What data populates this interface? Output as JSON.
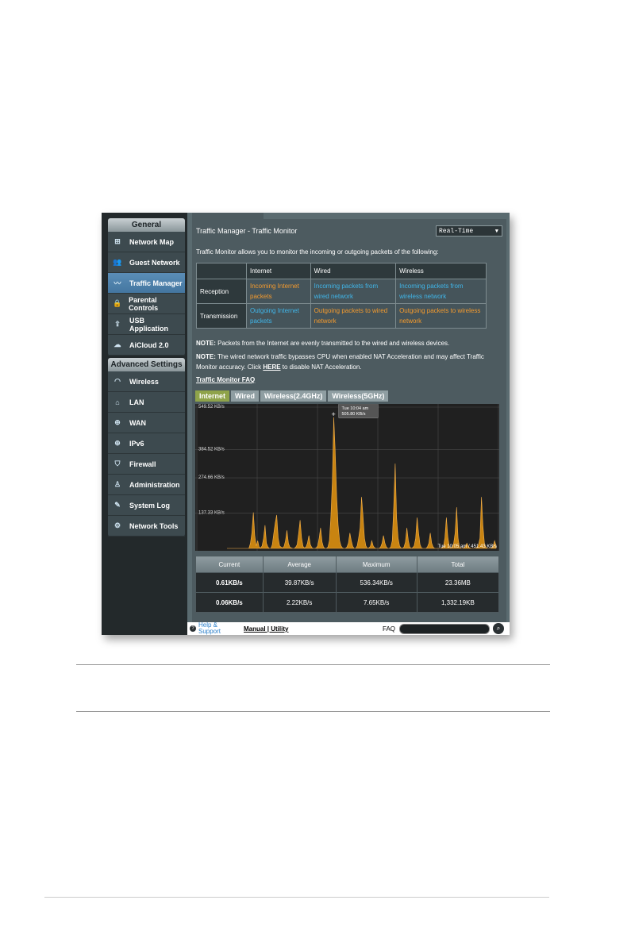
{
  "sidebar": {
    "general_title": "General",
    "general_items": [
      {
        "label": "Network Map",
        "icon": "network-map-icon"
      },
      {
        "label": "Guest Network",
        "icon": "guest-network-icon"
      },
      {
        "label": "Traffic Manager",
        "icon": "traffic-manager-icon",
        "active": true
      },
      {
        "label": "Parental Controls",
        "icon": "lock-icon"
      },
      {
        "label": "USB Application",
        "icon": "usb-icon"
      },
      {
        "label": "AiCloud 2.0",
        "icon": "cloud-icon"
      }
    ],
    "advanced_title": "Advanced Settings",
    "advanced_items": [
      {
        "label": "Wireless",
        "icon": "wifi-icon"
      },
      {
        "label": "LAN",
        "icon": "home-icon"
      },
      {
        "label": "WAN",
        "icon": "globe-icon"
      },
      {
        "label": "IPv6",
        "icon": "ipv6-icon"
      },
      {
        "label": "Firewall",
        "icon": "shield-icon"
      },
      {
        "label": "Administration",
        "icon": "user-icon"
      },
      {
        "label": "System Log",
        "icon": "log-icon"
      },
      {
        "label": "Network Tools",
        "icon": "tools-icon"
      }
    ]
  },
  "main": {
    "title": "Traffic Manager - Traffic Monitor",
    "mode_select": "Real-Time",
    "description": "Traffic Monitor allows you to monitor the incoming or outgoing packets of the following:",
    "table": {
      "headers": [
        "",
        "Internet",
        "Wired",
        "Wireless"
      ],
      "rows": [
        {
          "label": "Reception",
          "cells": [
            "Incoming Internet packets",
            "Incoming packets from wired network",
            "Incoming packets from wireless network"
          ]
        },
        {
          "label": "Transmission",
          "cells": [
            "Outgoing Internet packets",
            "Outgoing packets to wired network",
            "Outgoing packets to wireless network"
          ]
        }
      ]
    },
    "note1_label": "NOTE:",
    "note1_text": " Packets from the Internet are evenly transmitted to the wired and wireless devices.",
    "note2_label": "NOTE:",
    "note2_text": " The wired network traffic bypasses CPU when enabled NAT Acceleration and may affect Traffic Monitor accuracy. Click ",
    "note2_link": "HERE",
    "note2_tail": " to disable NAT Acceleration.",
    "faq_link": "Traffic Monitor FAQ",
    "chart_tabs": [
      "Internet",
      "Wired",
      "Wireless(2.4GHz)",
      "Wireless(5GHz)"
    ],
    "chart_tab_active": "Internet",
    "stats": {
      "headers": [
        "Current",
        "Average",
        "Maximum",
        "Total"
      ],
      "rows": [
        [
          "0.61KB/s",
          "39.87KB/s",
          "536.34KB/s",
          "23.36MB"
        ],
        [
          "0.06KB/s",
          "2.22KB/s",
          "7.65KB/s",
          "1,332.19KB"
        ]
      ]
    }
  },
  "chart_data": {
    "type": "area",
    "y_ticks": [
      "549.52 KB/s",
      "384.52 KB/s",
      "274.66 KB/s",
      "137.33 KB/s"
    ],
    "tooltip": {
      "time": "Tue 10:04 am",
      "value": "505.80 KB/s"
    },
    "bottom_label": "Tue 10:05 am / 451.43 KB/s",
    "ylim": [
      0,
      549.52
    ],
    "series": [
      {
        "color": "#e8960f",
        "values": [
          0,
          0,
          0,
          0,
          0,
          0,
          0,
          0,
          0,
          0,
          0,
          0,
          0,
          0,
          0,
          0,
          20,
          60,
          140,
          50,
          10,
          30,
          5,
          2,
          10,
          40,
          90,
          20,
          5,
          0,
          0,
          15,
          60,
          100,
          130,
          40,
          10,
          5,
          2,
          8,
          30,
          70,
          20,
          5,
          2,
          0,
          0,
          5,
          15,
          60,
          110,
          40,
          8,
          2,
          5,
          20,
          50,
          15,
          3,
          0,
          0,
          2,
          10,
          40,
          80,
          25,
          5,
          0,
          0,
          5,
          30,
          120,
          260,
          510,
          380,
          200,
          90,
          30,
          10,
          2,
          0,
          0,
          5,
          20,
          60,
          30,
          8,
          0,
          0,
          10,
          40,
          80,
          200,
          130,
          40,
          10,
          0,
          2,
          8,
          30,
          10,
          2,
          0,
          0,
          0,
          5,
          20,
          50,
          20,
          5,
          0,
          0,
          5,
          30,
          160,
          330,
          120,
          40,
          10,
          2,
          0,
          5,
          25,
          80,
          30,
          5,
          0,
          3,
          10,
          40,
          120,
          60,
          15,
          2,
          0,
          0,
          0,
          5,
          20,
          60,
          20,
          5,
          0,
          0,
          0,
          0,
          0,
          2,
          8,
          40,
          120,
          45,
          10,
          0,
          5,
          20,
          60,
          160,
          40,
          5,
          0,
          0,
          2,
          8,
          20,
          8,
          2,
          0,
          0,
          0,
          0,
          5,
          15,
          40,
          200,
          90,
          20,
          5,
          0,
          0,
          0,
          2,
          10,
          30,
          10
        ]
      }
    ]
  }
}
